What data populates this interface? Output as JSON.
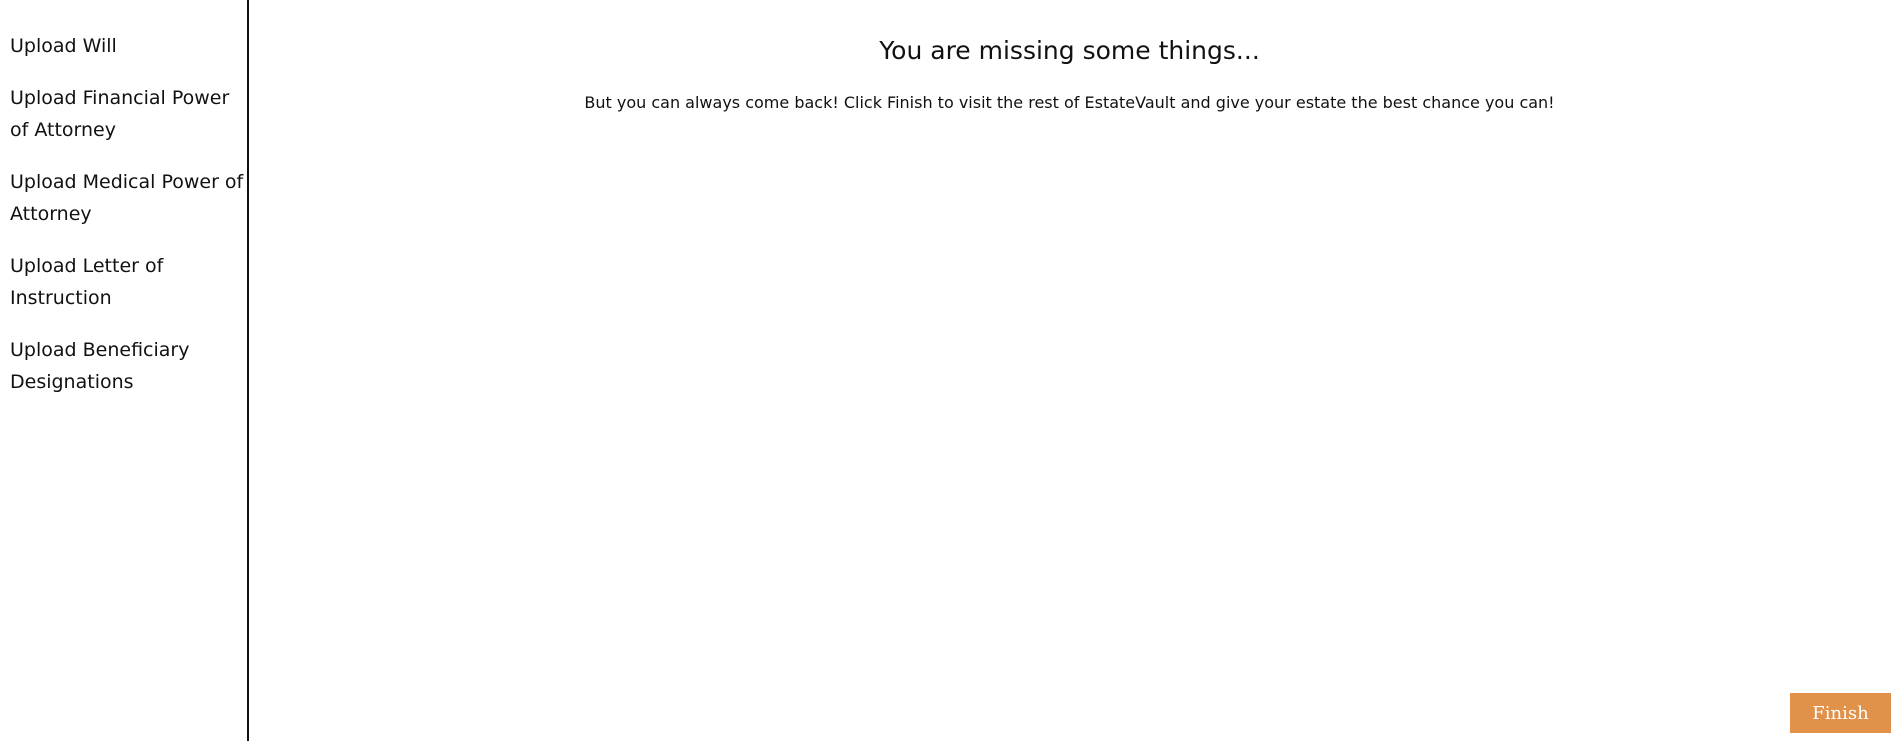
{
  "sidebar": {
    "items": [
      {
        "label": "Upload Will"
      },
      {
        "label": "Upload Financial Power of Attorney"
      },
      {
        "label": "Upload Medical Power of Attorney"
      },
      {
        "label": "Upload Letter of Instruction"
      },
      {
        "label": "Upload Beneficiary Designations"
      }
    ]
  },
  "main": {
    "title": "You are missing some things...",
    "message": "But you can always come back! Click Finish to visit the rest of EstateVault and give your estate the best chance you can!"
  },
  "actions": {
    "finish_label": "Finish"
  },
  "colors": {
    "finish_button_background": "#e0914a",
    "finish_button_text": "#ffffff",
    "sidebar_divider": "#111111"
  }
}
